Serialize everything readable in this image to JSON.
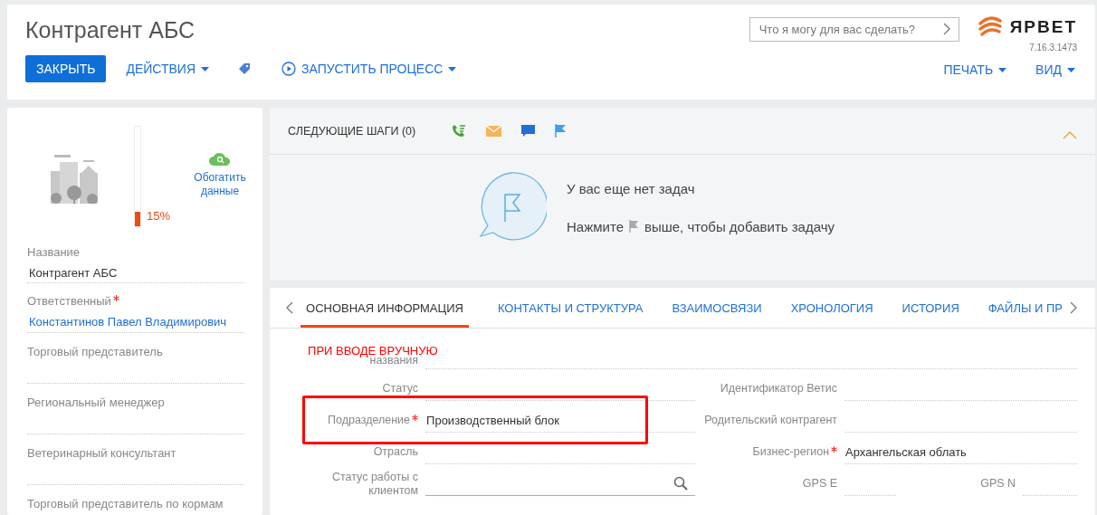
{
  "header": {
    "title": "Контрагент АБС",
    "search": {
      "placeholder": "Что я могу для вас сделать?"
    },
    "logo": "ЯРВЕТ",
    "version": "7.16.3.1473",
    "actions": [
      {
        "kind": "primary",
        "label": "ЗАКРЫТЬ"
      },
      {
        "kind": "menu",
        "label": "ДЕЙСТВИЯ"
      },
      {
        "kind": "tag"
      },
      {
        "kind": "process",
        "label": "ЗАПУСТИТЬ ПРОЦЕСС"
      }
    ],
    "right_actions": [
      {
        "label": "ПЕЧАТЬ"
      },
      {
        "label": "ВИД"
      }
    ]
  },
  "profile": {
    "completeness": {
      "level": 0.15,
      "reading": "15%"
    },
    "enrich_link": "Обогатить данные",
    "fields": [
      {
        "label": "Название",
        "value": "Контрагент АБС",
        "required": false,
        "kind": "text"
      },
      {
        "label": "Ответственный",
        "value": "Константинов Павел Владимирович",
        "required": true,
        "kind": "link"
      },
      {
        "label": "Торговый представитель",
        "required": false,
        "kind": "text"
      },
      {
        "label": "Региональный менеджер",
        "required": false,
        "kind": "text"
      },
      {
        "label": "Ветеринарный консультант",
        "required": false,
        "kind": "text"
      },
      {
        "label": "Торговый представитель по кормам",
        "required": false,
        "kind": "text"
      }
    ]
  },
  "next_steps": {
    "title": "СЛЕДУЮЩИЕ ШАГИ (0)",
    "empty_title": "У вас еще нет задач",
    "hint_before": "Нажмите",
    "hint_after": "выше, чтобы добавить задачу"
  },
  "tabs": [
    {
      "label": "ОСНОВНАЯ ИНФОРМАЦИЯ",
      "selected": true
    },
    {
      "label": "КОНТАКТЫ И СТРУКТУРА",
      "selected": false
    },
    {
      "label": "ВЗАИМОСВЯЗИ",
      "selected": false
    },
    {
      "label": "ХРОНОЛОГИЯ",
      "selected": false
    },
    {
      "label": "ИСТОРИЯ",
      "selected": false
    },
    {
      "label": "ФАЙЛЫ И ПР",
      "selected": false
    }
  ],
  "annotation": "ПРИ ВВОДЕ ВРУЧНУЮ",
  "form": {
    "rows": [
      [
        {
          "label": "названия",
          "required": false,
          "kind": "text"
        }
      ],
      [
        {
          "label": "Статус",
          "required": false,
          "kind": "text"
        },
        {
          "label": "Идентификатор Ветис",
          "required": false,
          "kind": "text"
        }
      ],
      [
        {
          "label": "Подразделение",
          "value": "Производственный блок",
          "required": true,
          "kind": "text"
        },
        {
          "label": "Родительский контрагент",
          "required": false,
          "kind": "text"
        }
      ],
      [
        {
          "label": "Отрасль",
          "required": false,
          "kind": "text"
        },
        {
          "label": "Бизнес-регион",
          "value": "Архангельская облать",
          "required": true,
          "kind": "text"
        }
      ],
      [
        {
          "label": "Статус работы с клиентом",
          "required": false,
          "kind": "lookup"
        },
        {
          "label": "GPS E",
          "required": false,
          "kind": "text"
        },
        {
          "label": "GPS N",
          "required": false,
          "kind": "text"
        }
      ]
    ]
  }
}
